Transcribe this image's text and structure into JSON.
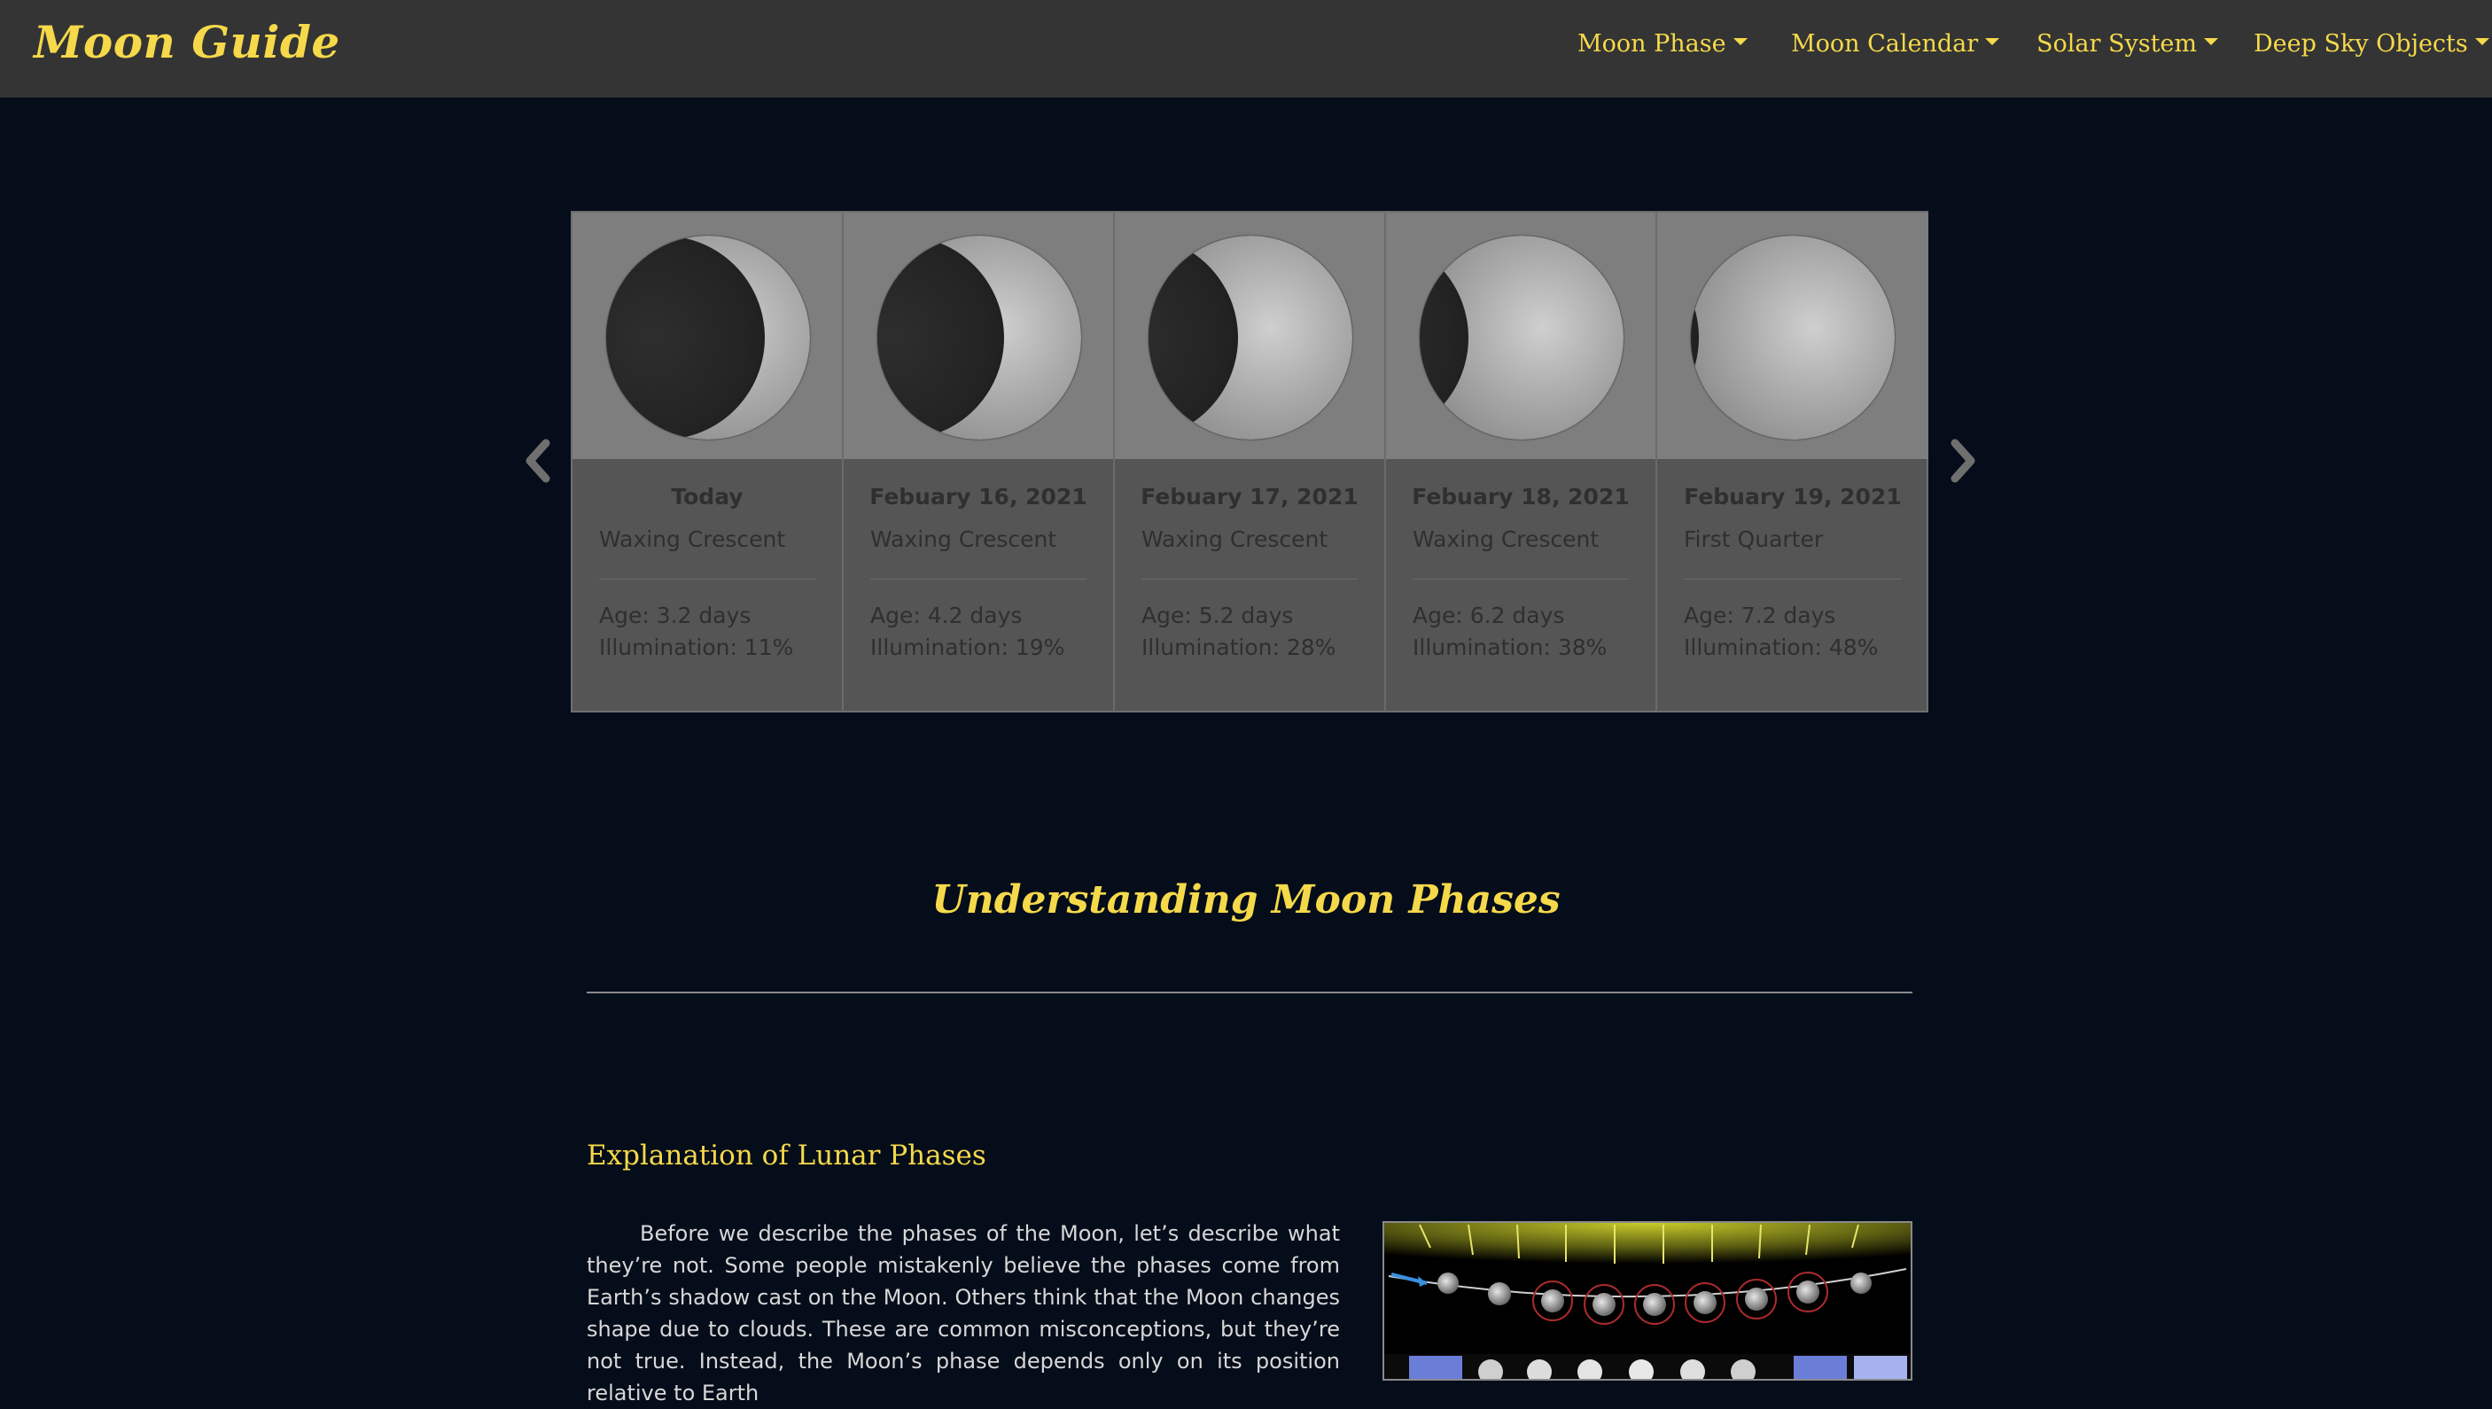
{
  "navbar": {
    "brand": "Moon Guide",
    "items": [
      {
        "label": "Moon Phase"
      },
      {
        "label": "Moon Calendar"
      },
      {
        "label": "Solar System"
      },
      {
        "label": "Deep Sky Objects"
      }
    ]
  },
  "carousel": {
    "cards": [
      {
        "date": "Today",
        "phase": "Waxing Crescent",
        "age": "Age: 3.2 days",
        "illumination": "Illumination: 11%",
        "illumination_fraction": 0.11
      },
      {
        "date": "Febuary 16, 2021",
        "phase": "Waxing Crescent",
        "age": "Age: 4.2 days",
        "illumination": "Illumination: 19%",
        "illumination_fraction": 0.19
      },
      {
        "date": "Febuary 17, 2021",
        "phase": "Waxing Crescent",
        "age": "Age: 5.2 days",
        "illumination": "Illumination: 28%",
        "illumination_fraction": 0.28
      },
      {
        "date": "Febuary 18, 2021",
        "phase": "Waxing Crescent",
        "age": "Age: 6.2 days",
        "illumination": "Illumination: 38%",
        "illumination_fraction": 0.38
      },
      {
        "date": "Febuary 19, 2021",
        "phase": "First Quarter",
        "age": "Age: 7.2 days",
        "illumination": "Illumination: 48%",
        "illumination_fraction": 0.48
      }
    ]
  },
  "section": {
    "title": "Understanding Moon Phases",
    "subtitle": "Explanation of Lunar Phases",
    "paragraph": "Before we describe the phases of the Moon, let’s describe what they’re not. Some people mistakenly believe the phases come from Earth’s shadow cast on the Moon. Others think that the Moon changes shape due to clouds. These are common misconceptions, but they’re not true. Instead, the Moon’s phase depends only on its position relative to Earth"
  },
  "icons": {
    "prev": "chevron-left-icon",
    "next": "chevron-right-icon",
    "dropdown": "caret-down-icon"
  },
  "colors": {
    "accent": "#f5d94a",
    "page_bg": "#050d1a",
    "navbar_bg": "#343434",
    "card_bg": "#555555",
    "card_image_bg": "#7e7e7e"
  }
}
